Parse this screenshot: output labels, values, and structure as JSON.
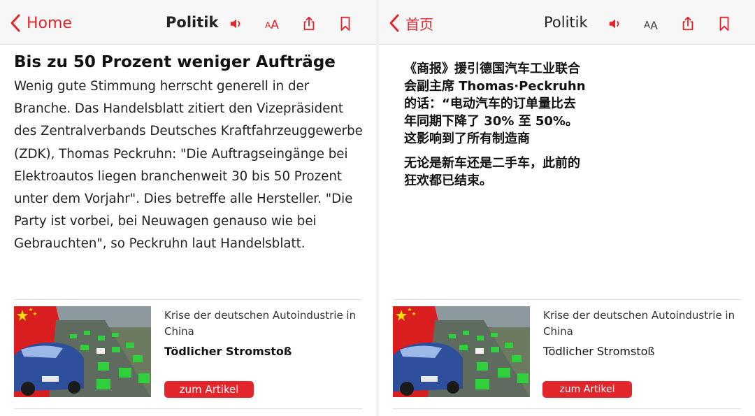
{
  "colors": {
    "accent": "#e3262c",
    "topbar": "#f7f7f7"
  },
  "left": {
    "nav": {
      "back_label": "Home",
      "title": "Politik",
      "textsize_label": "AA"
    },
    "article": {
      "headline": "Bis zu 50 Prozent weniger Aufträge",
      "body": "Wenig gute Stimmung herrscht generell in der Branche. Das Handelsblatt zitiert den Vizepräsident des Zentralverbands Deutsches Kraftfahrzeuggewerbe (ZDK), Thomas Peckruhn: \"Die Auftragseingänge bei Elektroautos liegen branchenweit 30 bis 50 Prozent unter dem Vorjahr\". Dies betreffe alle Hersteller. \"Die Party ist vorbei, bei Neuwagen genauso wie bei Gebrauchten\", so Peckruhn laut Handelsblatt."
    },
    "teaser": {
      "kicker": "Krise der deutschen Autoindustrie in China",
      "title": "Tödlicher Stromstoß",
      "button": "zum Artikel"
    }
  },
  "right": {
    "nav": {
      "back_label": "首页",
      "title": "Politik",
      "textsize_label": "AA"
    },
    "translation": {
      "para1": "《商报》援引德国汽车工业联合会副主席 Thomas·Peckruhn 的话：“电动汽车的订单量比去年同期下降了 30% 至 50%。这影响到了所有制造商",
      "para2": "无论是新车还是二手车，此前的狂欢都已结束。"
    },
    "teaser": {
      "kicker": "Krise der deutschen Autoindustrie in China",
      "title": "Tödlicher Stromstoß",
      "button": "zum Artikel"
    }
  }
}
